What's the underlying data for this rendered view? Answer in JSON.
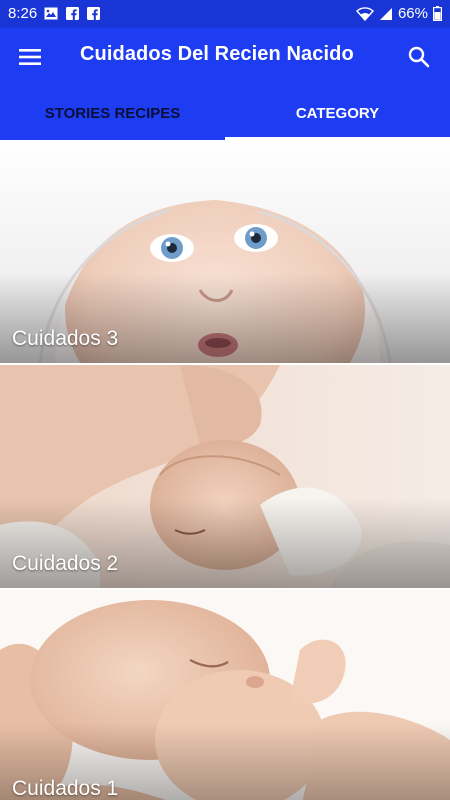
{
  "status_bar": {
    "time": "8:26",
    "battery": "66%",
    "notification_icons": [
      "image-icon",
      "facebook-icon",
      "facebook-icon"
    ]
  },
  "app_bar": {
    "title": "Cuidados Del Recien Nacido",
    "background": "#1e3cf2"
  },
  "tabs": [
    {
      "label": "STORIES RECIPES",
      "active": false
    },
    {
      "label": "CATEGORY",
      "active": true
    }
  ],
  "cards": [
    {
      "title": "Cuidados 3"
    },
    {
      "title": "Cuidados 2"
    },
    {
      "title": "Cuidados 1"
    }
  ]
}
